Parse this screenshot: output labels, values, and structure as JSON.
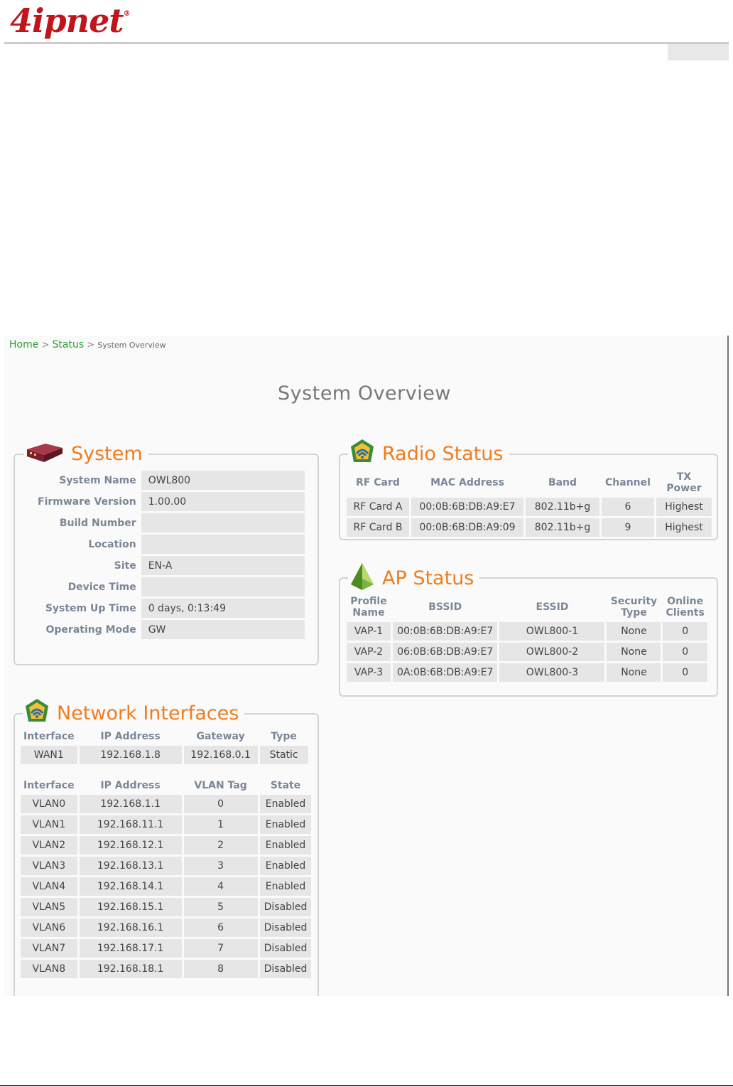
{
  "brand": {
    "logo_text": "4ipnet",
    "registered": "®"
  },
  "breadcrumb": {
    "home": "Home",
    "status": "Status",
    "current": "System Overview",
    "sep": ">"
  },
  "page_title": "System Overview",
  "system": {
    "title": "System",
    "rows": [
      {
        "label": "System Name",
        "value": "OWL800"
      },
      {
        "label": "Firmware Version",
        "value": "1.00.00"
      },
      {
        "label": "Build Number",
        "value": ""
      },
      {
        "label": "Location",
        "value": ""
      },
      {
        "label": "Site",
        "value": "EN-A"
      },
      {
        "label": "Device Time",
        "value": ""
      },
      {
        "label": "System Up Time",
        "value": "0 days, 0:13:49"
      },
      {
        "label": "Operating Mode",
        "value": "GW"
      }
    ]
  },
  "radio": {
    "title": "Radio Status",
    "headers": [
      "RF Card",
      "MAC Address",
      "Band",
      "Channel",
      "TX Power"
    ],
    "rows": [
      [
        "RF Card A",
        "00:0B:6B:DB:A9:E7",
        "802.11b+g",
        "6",
        "Highest"
      ],
      [
        "RF Card B",
        "00:0B:6B:DB:A9:09",
        "802.11b+g",
        "9",
        "Highest"
      ]
    ]
  },
  "ap": {
    "title": "AP Status",
    "headers": [
      "Profile Name",
      "BSSID",
      "ESSID",
      "Security Type",
      "Online Clients"
    ],
    "rows": [
      [
        "VAP-1",
        "00:0B:6B:DB:A9:E7",
        "OWL800-1",
        "None",
        "0"
      ],
      [
        "VAP-2",
        "06:0B:6B:DB:A9:E7",
        "OWL800-2",
        "None",
        "0"
      ],
      [
        "VAP-3",
        "0A:0B:6B:DB:A9:E7",
        "OWL800-3",
        "None",
        "0"
      ]
    ]
  },
  "network": {
    "title": "Network Interfaces",
    "wan_headers": [
      "Interface",
      "IP Address",
      "Gateway",
      "Type"
    ],
    "wan_rows": [
      [
        "WAN1",
        "192.168.1.8",
        "192.168.0.1",
        "Static"
      ]
    ],
    "vlan_headers": [
      "Interface",
      "IP Address",
      "VLAN Tag",
      "State"
    ],
    "vlan_rows": [
      [
        "VLAN0",
        "192.168.1.1",
        "0",
        "Enabled"
      ],
      [
        "VLAN1",
        "192.168.11.1",
        "1",
        "Enabled"
      ],
      [
        "VLAN2",
        "192.168.12.1",
        "2",
        "Enabled"
      ],
      [
        "VLAN3",
        "192.168.13.1",
        "3",
        "Enabled"
      ],
      [
        "VLAN4",
        "192.168.14.1",
        "4",
        "Enabled"
      ],
      [
        "VLAN5",
        "192.168.15.1",
        "5",
        "Disabled"
      ],
      [
        "VLAN6",
        "192.168.16.1",
        "6",
        "Disabled"
      ],
      [
        "VLAN7",
        "192.168.17.1",
        "7",
        "Disabled"
      ],
      [
        "VLAN8",
        "192.168.18.1",
        "8",
        "Disabled"
      ]
    ]
  },
  "colors": {
    "accent_orange": "#f07c1e",
    "link_green": "#2e9b2e",
    "brand_red": "#c0161b",
    "label_gray": "#7b8797"
  },
  "icons": {
    "system": "router-device-icon",
    "radio": "wireless-shield-icon",
    "ap": "access-point-pyramid-icon",
    "network": "network-shield-icon"
  }
}
